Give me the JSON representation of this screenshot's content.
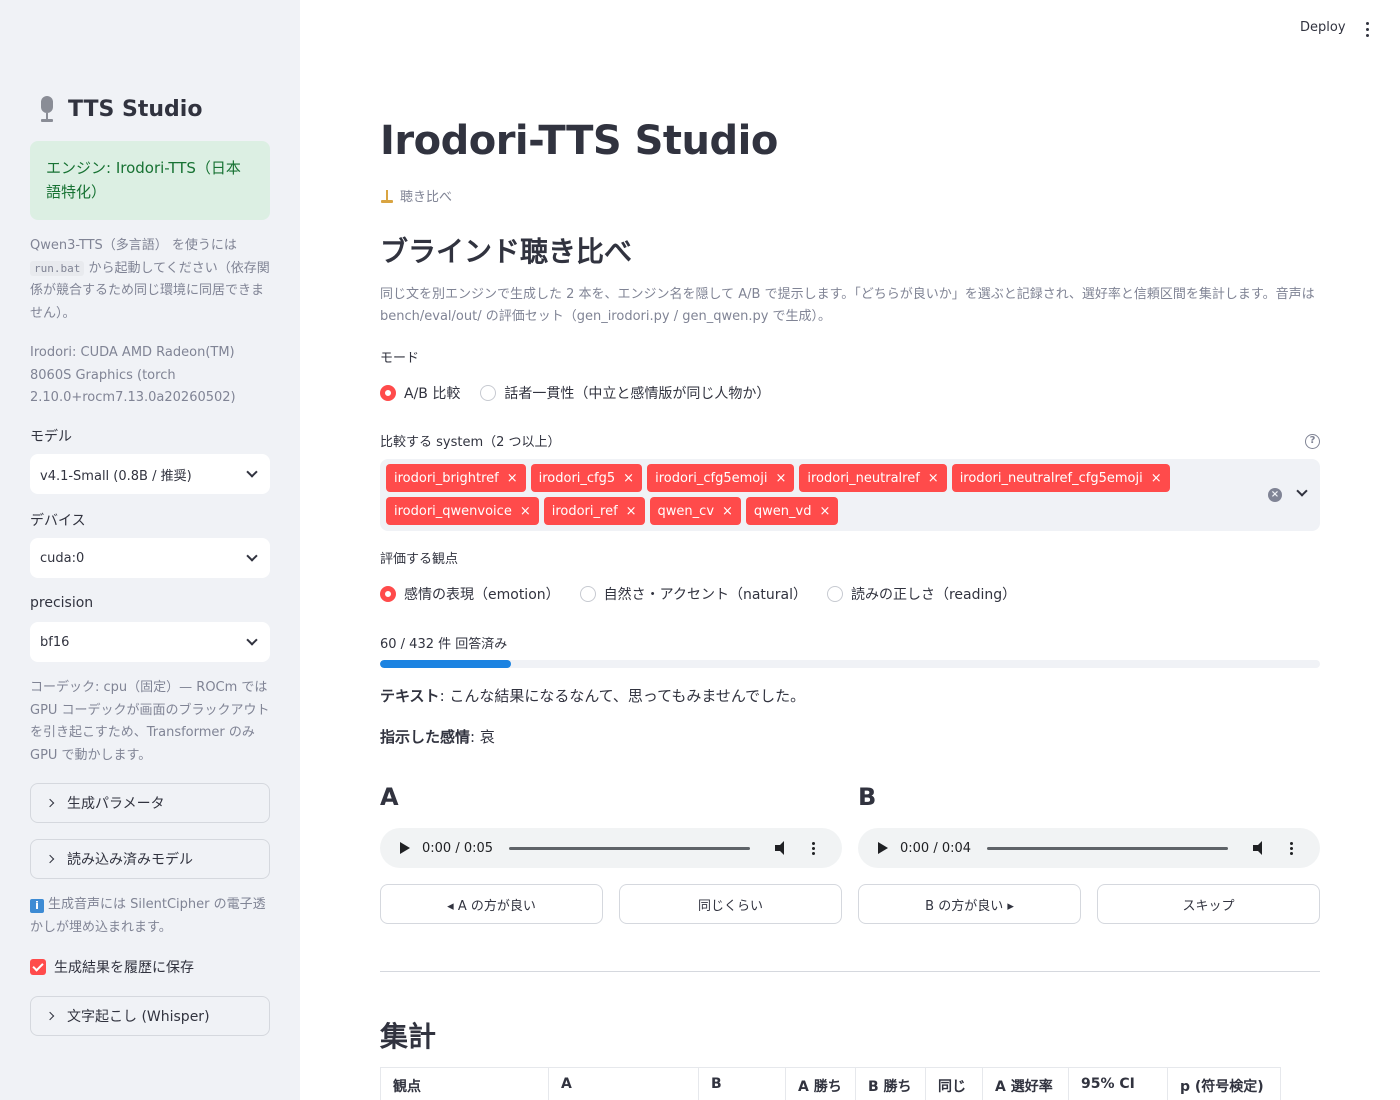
{
  "sidebar": {
    "title": "TTS Studio",
    "engine_notice": "エンジン: Irodori-TTS（日本語特化）",
    "qwen_note_pre": "Qwen3-TTS（多言語） を使うには ",
    "qwen_note_code": "run.bat",
    "qwen_note_post": " から起動してください（依存関係が競合するため同じ環境に同居できません）。",
    "device_info": "Irodori: CUDA AMD Radeon(TM) 8060S Graphics (torch 2.10.0+rocm7.13.0a20260502)",
    "model_label": "モデル",
    "model_value": "v4.1-Small (0.8B / 推奨)",
    "device_label": "デバイス",
    "device_value": "cuda:0",
    "precision_label": "precision",
    "precision_value": "bf16",
    "codec_note": "コーデック: cpu（固定）— ROCm では GPU コーデックが画面のブラックアウトを引き起こすため、Transformer のみ GPU で動かします。",
    "expander_gen_params": "生成パラメータ",
    "expander_loaded_models": "読み込み済みモデル",
    "watermark_note": "生成音声には SilentCipher の電子透かしが埋め込まれます。",
    "save_history_label": "生成結果を履歴に保存",
    "expander_whisper": "文字起こし (Whisper)"
  },
  "header": {
    "deploy": "Deploy"
  },
  "main": {
    "title": "Irodori-TTS Studio",
    "caption": "聴き比べ",
    "section_title": "ブラインド聴き比べ",
    "description": "同じ文を別エンジンで生成した 2 本を、エンジン名を隠して A/B で提示します。「どちらが良いか」を選ぶと記録され、選好率と信頼区間を集計します。音声は bench/eval/out/ の評価セット（gen_irodori.py / gen_qwen.py で生成）。",
    "mode_label": "モード",
    "mode_options": [
      "A/B 比較",
      "話者一貫性（中立と感情版が同じ人物か）"
    ],
    "systems_label": "比較する system（2 つ以上）",
    "systems": [
      "irodori_brightref",
      "irodori_cfg5",
      "irodori_cfg5emoji",
      "irodori_neutralref",
      "irodori_neutralref_cfg5emoji",
      "irodori_qwenvoice",
      "irodori_ref",
      "qwen_cv",
      "qwen_vd"
    ],
    "aspect_label": "評価する観点",
    "aspect_options": [
      "感情の表現（emotion）",
      "自然さ・アクセント（natural）",
      "読みの正しさ（reading）"
    ],
    "progress_text": "60 / 432 件 回答済み",
    "progress_fraction": 0.139,
    "text_key": "テキスト",
    "text_value": ": こんな結果になるなんて、思ってもみませんでした。",
    "emotion_key": "指示した感情",
    "emotion_value": ": 哀",
    "a_label": "A",
    "b_label": "B",
    "audio_a_time": "0:00 / 0:05",
    "audio_b_time": "0:00 / 0:04",
    "buttons": [
      "◂ A の方が良い",
      "同じくらい",
      "B の方が良い ▸",
      "スキップ"
    ],
    "summary_title": "集計",
    "table_headers": [
      "観点",
      "A",
      "B",
      "A 勝ち",
      "B 勝ち",
      "同じ",
      "A 選好率",
      "95% CI",
      "p (符号検定)"
    ]
  },
  "colors": {
    "accent": "#ff4b4b",
    "progress": "#1c83e1",
    "success_bg": "#dcefe3",
    "success_text": "#177233"
  }
}
